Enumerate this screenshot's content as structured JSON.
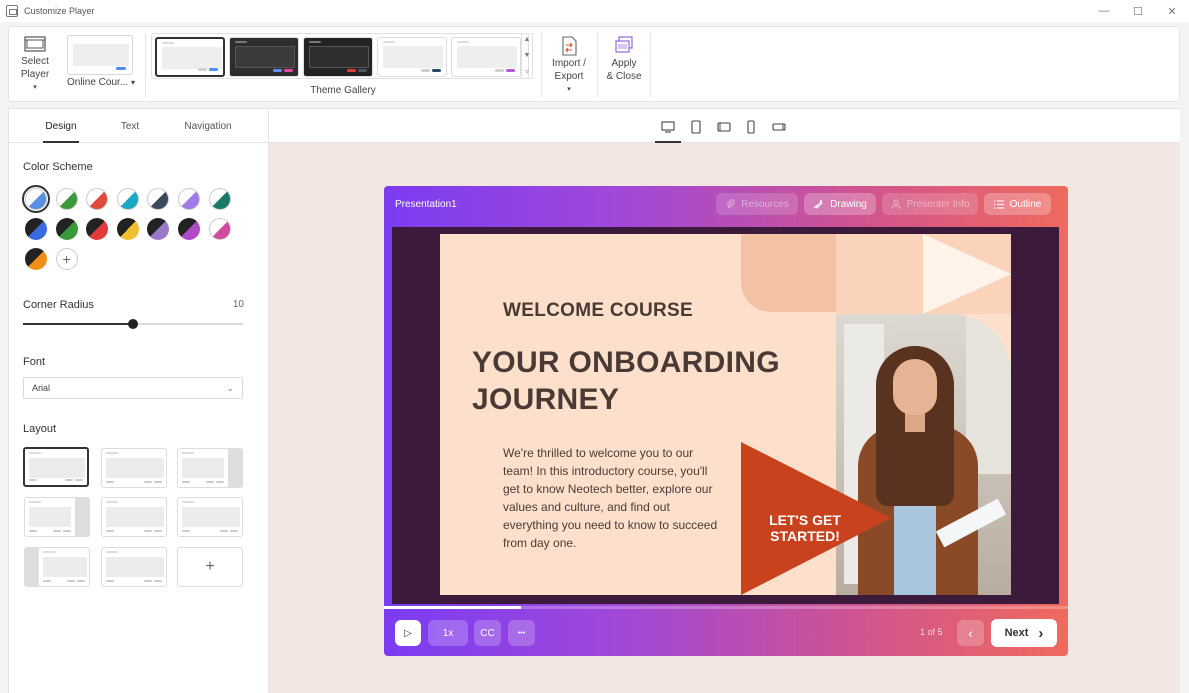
{
  "window": {
    "title": "Customize Player",
    "controls": {
      "minimize": "—",
      "maximize": "☐",
      "close": "✕"
    }
  },
  "ribbon": {
    "select_player": {
      "label_line1": "Select",
      "label_line2": "Player",
      "dropdown": "▾"
    },
    "player_dropdown": {
      "value": "Online Cour...",
      "chevron": "▾"
    },
    "theme_gallery": {
      "label": "Theme Gallery",
      "themes": [
        {
          "bg": "#ffffff",
          "inner": "#eeeeee",
          "accent1": "#d0d0d0",
          "accent2": "#4a8ff0",
          "selected": true
        },
        {
          "bg": "#2e2e2e",
          "inner": "#3a3a3a",
          "accent1": "#6c8cf0",
          "accent2": "#e04aa4",
          "selected": false
        },
        {
          "bg": "#232323",
          "inner": "#2f2f2f",
          "accent1": "#e23a3a",
          "accent2": "#555555",
          "selected": false
        },
        {
          "bg": "#ffffff",
          "inner": "#eeeeee",
          "accent1": "#d0d0d0",
          "accent2": "#2a4a6a",
          "selected": false
        },
        {
          "bg": "#ffffff",
          "inner": "#eeeeee",
          "accent1": "#d0d0d0",
          "accent2": "#b05ae0",
          "selected": false
        }
      ],
      "scroll_up": "▲",
      "scroll_down": "▼",
      "scroll_more": "▿"
    },
    "import_export": {
      "label_line1": "Import /",
      "label_line2": "Export",
      "dropdown": "▾"
    },
    "apply_close": {
      "label_line1": "Apply",
      "label_line2": "& Close"
    }
  },
  "left_panel": {
    "tabs": [
      {
        "label": "Design",
        "active": true
      },
      {
        "label": "Text",
        "active": false
      },
      {
        "label": "Navigation",
        "active": false
      }
    ],
    "color_scheme": {
      "title": "Color Scheme",
      "swatches": [
        {
          "a": "#ffffff",
          "b": "#5a8fe0",
          "selected": true
        },
        {
          "a": "#ffffff",
          "b": "#3a9a3a"
        },
        {
          "a": "#ffffff",
          "b": "#e04a3a"
        },
        {
          "a": "#ffffff",
          "b": "#1aa8c8"
        },
        {
          "a": "#ffffff",
          "b": "#3a4a5a"
        },
        {
          "a": "#ffffff",
          "b": "#a07ae8"
        },
        {
          "a": "#ffffff",
          "b": "#1a7a6a"
        },
        {
          "a": "#222222",
          "b": "#3a6ae0"
        },
        {
          "a": "#222222",
          "b": "#3a9a3a"
        },
        {
          "a": "#222222",
          "b": "#e03a3a"
        },
        {
          "a": "#222222",
          "b": "#f0c030"
        },
        {
          "a": "#222222",
          "b": "#9a7ac8"
        },
        {
          "a": "#222222",
          "b": "#b04ac8"
        },
        {
          "a": "#ffffff",
          "b": "#d04aa0"
        },
        {
          "a": "#222222",
          "b": "#f0901a"
        }
      ],
      "add_label": "+"
    },
    "corner_radius": {
      "title": "Corner Radius",
      "value": "10",
      "fraction": 0.5
    },
    "font": {
      "title": "Font",
      "value": "Arial",
      "chevron": "⌄"
    },
    "layout": {
      "title": "Layout",
      "add_label": "+"
    }
  },
  "device_bar": {
    "devices": [
      "desktop-icon",
      "tablet-portrait-icon",
      "tablet-landscape-icon",
      "phone-portrait-icon",
      "phone-landscape-icon"
    ]
  },
  "player": {
    "title": "Presentation1",
    "top_buttons": [
      {
        "label": "Resources",
        "icon": "paperclip-icon",
        "bright": false
      },
      {
        "label": "Drawing",
        "icon": "drawing-icon",
        "bright": true
      },
      {
        "label": "Presenter Info",
        "icon": "person-icon",
        "bright": false
      },
      {
        "label": "Outline",
        "icon": "list-icon",
        "bright": true
      }
    ],
    "slide": {
      "welcome": "WELCOME COURSE",
      "headline": "YOUR ONBOARDING JOURNEY",
      "body": "We're thrilled to welcome you to our team! In this introductory course, you'll get to know Neotech better, explore our values and culture, and find out everything you need to know to succeed from day one.",
      "cta": "LET'S GET STARTED!",
      "cta_color": "#c9421e"
    },
    "progress": 0.2,
    "controls": {
      "play": "▷",
      "speed": "1x",
      "cc": "CC",
      "more": "•••",
      "pager": "1 of 5",
      "prev": "‹",
      "next": "Next",
      "next_chevron": "›"
    }
  }
}
